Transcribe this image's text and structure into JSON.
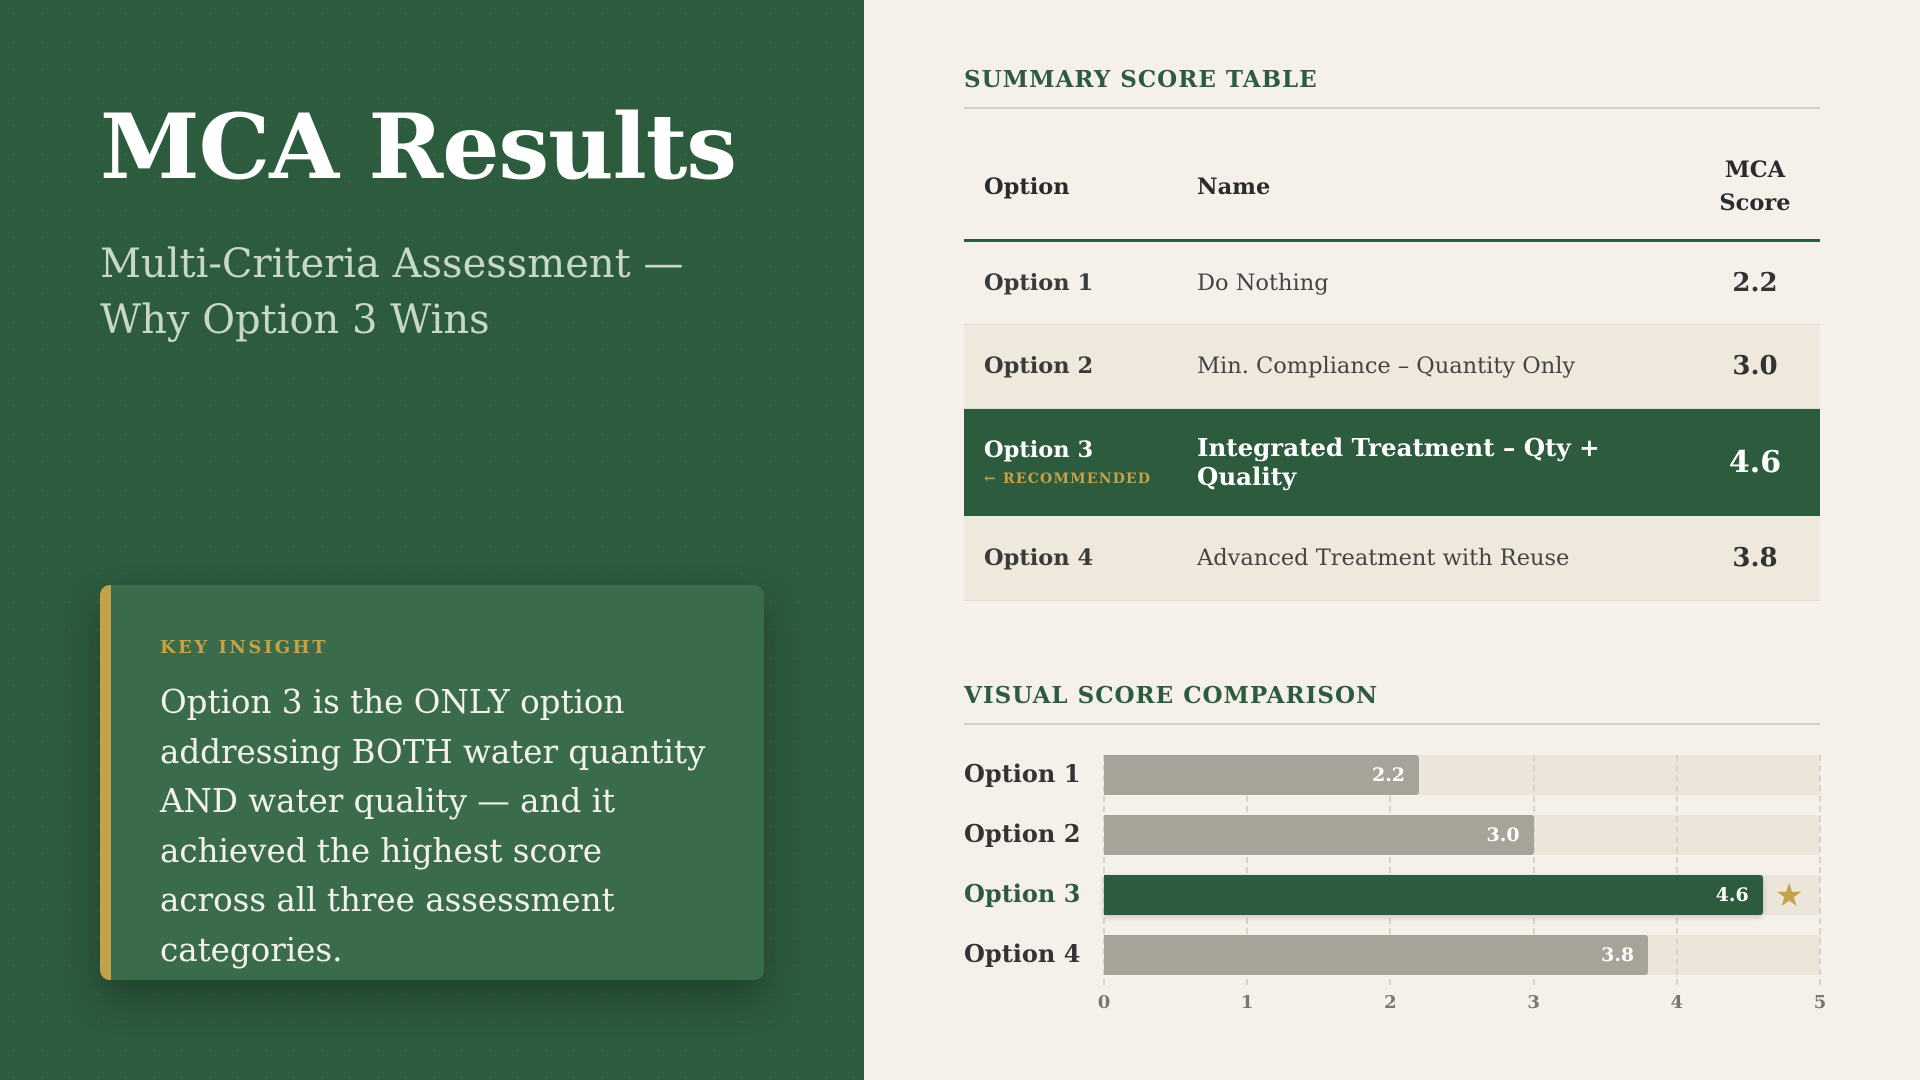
{
  "left": {
    "title": "MCA Results",
    "subtitle": "Multi-Criteria Assessment — Why Option 3 Wins",
    "insight": {
      "label": "KEY INSIGHT",
      "text": "Option 3 is the ONLY option addressing BOTH water quantity AND water quality — and it achieved the highest score across all three assessment categories."
    }
  },
  "table": {
    "section_title": "SUMMARY SCORE TABLE",
    "headers": {
      "option": "Option",
      "name": "Name",
      "score": "MCA Score"
    },
    "rows": [
      {
        "option": "Option 1",
        "name": "Do Nothing",
        "score": "2.2"
      },
      {
        "option": "Option 2",
        "name": "Min. Compliance – Quantity Only",
        "score": "3.0"
      },
      {
        "option": "Option 3",
        "name": "Integrated Treatment – Qty + Quality",
        "score": "4.6",
        "tag": "← RECOMMENDED"
      },
      {
        "option": "Option 4",
        "name": "Advanced Treatment with Reuse",
        "score": "3.8"
      }
    ]
  },
  "chart_section_title": "VISUAL SCORE COMPARISON",
  "chart_data": {
    "type": "bar",
    "orientation": "horizontal",
    "title": "VISUAL SCORE COMPARISON",
    "categories": [
      "Option 1",
      "Option 2",
      "Option 3",
      "Option 4"
    ],
    "values": [
      2.2,
      3.0,
      4.6,
      3.8
    ],
    "value_labels": [
      "2.2",
      "3.0",
      "4.6",
      "3.8"
    ],
    "highlight_index": 2,
    "xlim": [
      0,
      5
    ],
    "xticks": [
      "0",
      "1",
      "2",
      "3",
      "4",
      "5"
    ],
    "grid": true,
    "star_symbol": "★"
  },
  "colors": {
    "primary_green": "#2d5b3e",
    "gold_accent": "#c4a24a",
    "neutral_bar": "#a8a398",
    "background": "#f5f1ea"
  }
}
